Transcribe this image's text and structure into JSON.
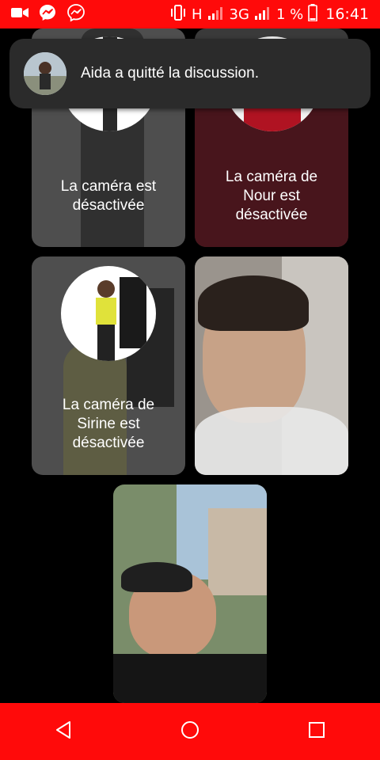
{
  "status_bar": {
    "left_icons": [
      "video-camera-icon",
      "messenger-icon",
      "messenger-icon"
    ],
    "network_h": "H",
    "network_3g": "3G",
    "battery_percent": "1 %",
    "time": "16:41"
  },
  "toast": {
    "message": "Aida a quitté la discussion."
  },
  "tiles": {
    "t1_caption": "La caméra est désactivée",
    "t2_caption": "La caméra de Nour est désactivée",
    "t3_caption": "La caméra de Sirine est désactivée"
  },
  "nav": {
    "back": "back-icon",
    "home": "home-icon",
    "recents": "recents-icon"
  },
  "colors": {
    "status_bar": "#ff0a0a",
    "nav_bar": "#ff0a0a",
    "toast_bg": "#2b2b2b",
    "tile_off": "#4e4e4e"
  }
}
